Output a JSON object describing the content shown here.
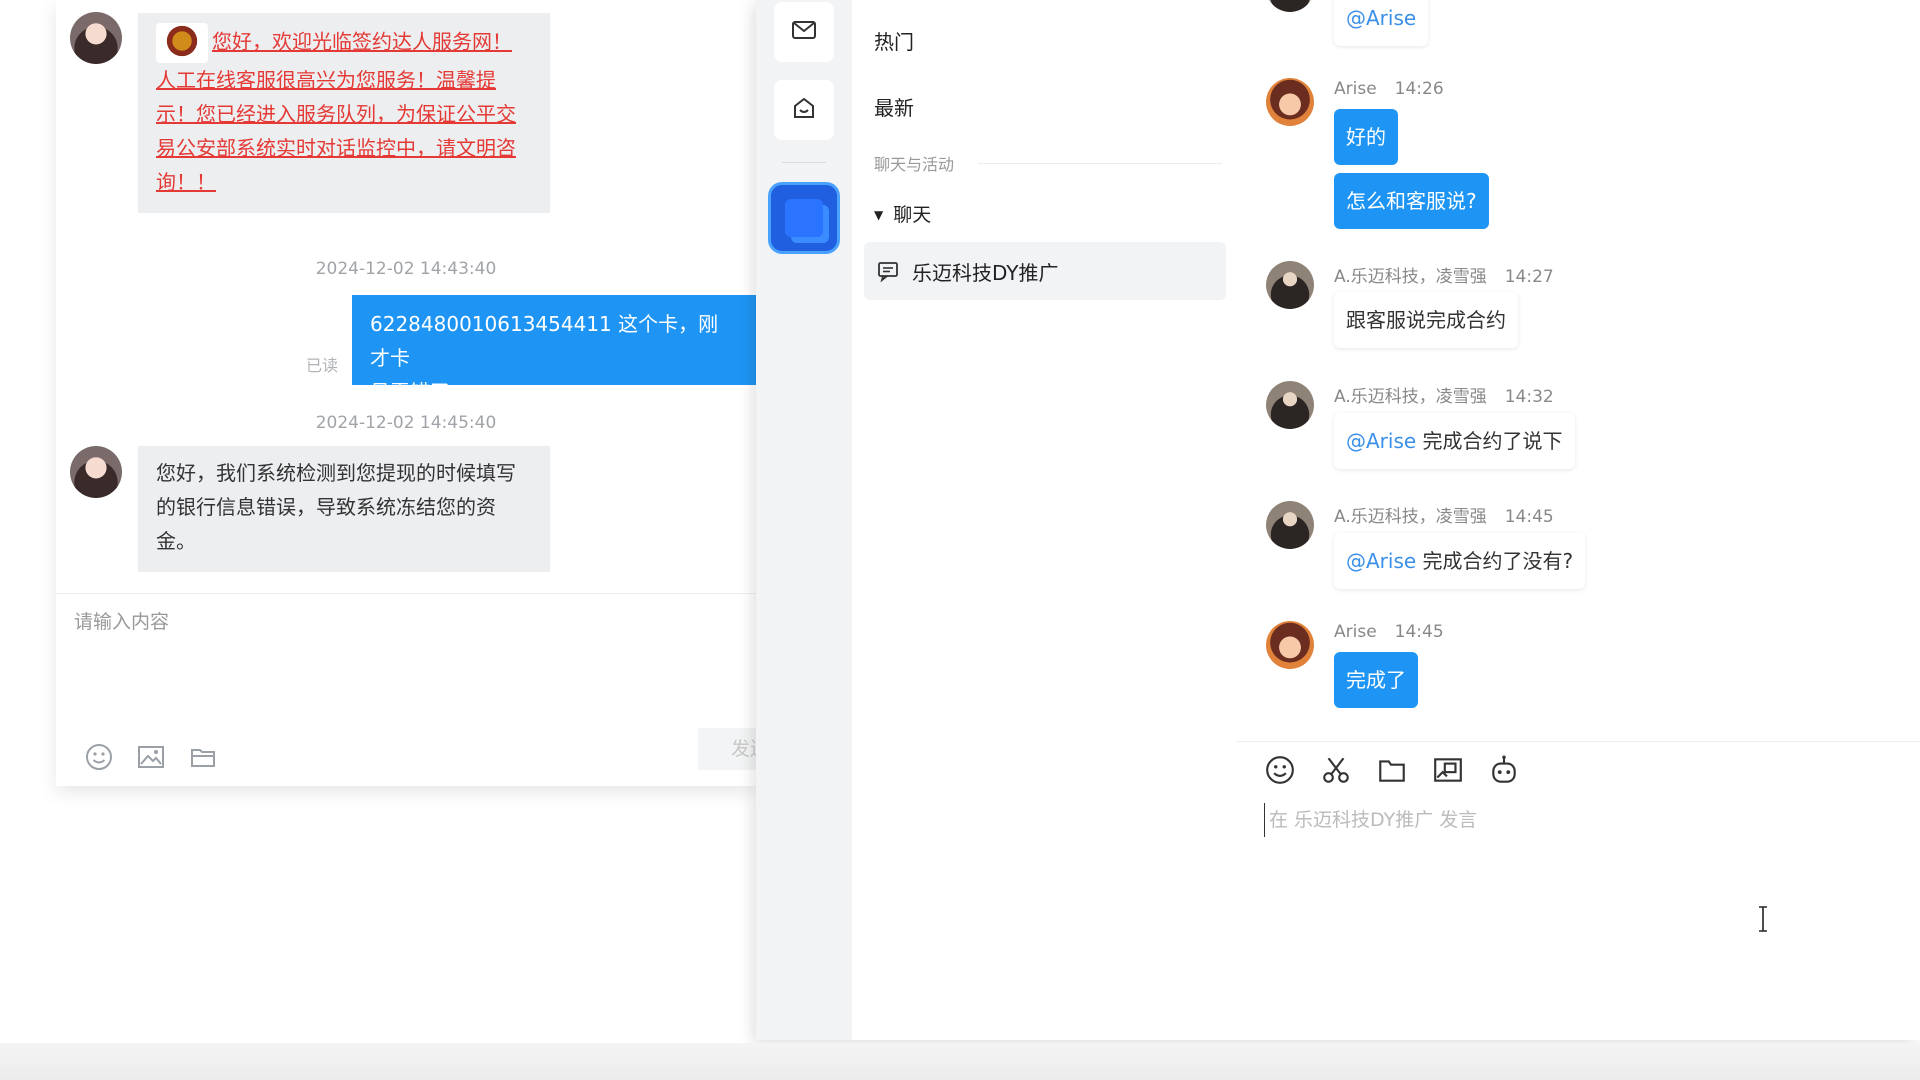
{
  "left_window": {
    "messages": [
      {
        "type": "notice",
        "lines": [
          "您好，欢迎光临签约达人服务网！",
          "人工在线客服很高兴为您服务！温馨提",
          "示！您已经进入服务队列，为保证公平交",
          "易公安部系统实时对话监控中，请文明咨",
          "询！！"
        ]
      },
      {
        "type": "timestamp",
        "text": "2024-12-02 14:43:40"
      },
      {
        "type": "outgoing",
        "lines": [
          "6228480010613454411 这个卡，刚才卡",
          "号弄错了。"
        ],
        "status": "已读"
      },
      {
        "type": "timestamp",
        "text": "2024-12-02 14:45:40"
      },
      {
        "type": "incoming",
        "lines": [
          "您好，我们系统检测到您提现的时候填写",
          "的银行信息错误，导致系统冻结您的资",
          "金。"
        ]
      }
    ],
    "input_placeholder": "请输入内容",
    "send_label": "发送"
  },
  "right_window": {
    "sidebar": {
      "items": [
        "热门",
        "最新"
      ],
      "section_label": "聊天与活动",
      "group_label": "聊天",
      "channel_label": "乐迈科技DY推广"
    },
    "chat": {
      "top_mention": "@Arise",
      "messages": [
        {
          "sender": "Arise",
          "time": "14:26",
          "bubbles": [
            "好的",
            "怎么和客服说?"
          ],
          "outgoing": true
        },
        {
          "sender": "A.乐迈科技，凌雪强",
          "time": "14:27",
          "text": "跟客服说完成合约",
          "outgoing": false
        },
        {
          "sender": "A.乐迈科技，凌雪强",
          "time": "14:32",
          "mention": "@Arise",
          "text": "完成合约了说下",
          "outgoing": false
        },
        {
          "sender": "A.乐迈科技，凌雪强",
          "time": "14:45",
          "mention": "@Arise",
          "text": "完成合约了没有?",
          "outgoing": false
        },
        {
          "sender": "Arise",
          "time": "14:45",
          "bubbles": [
            "完成了"
          ],
          "outgoing": true
        }
      ],
      "input_placeholder": "在 乐迈科技DY推广 发言",
      "tool_icons": [
        "emoji-icon",
        "scissors-icon",
        "folder-icon",
        "screenshot-icon",
        "robot-icon"
      ]
    }
  },
  "colors": {
    "accent": "#1e95f4",
    "notice": "#e53935",
    "mention": "#3a90e8"
  }
}
